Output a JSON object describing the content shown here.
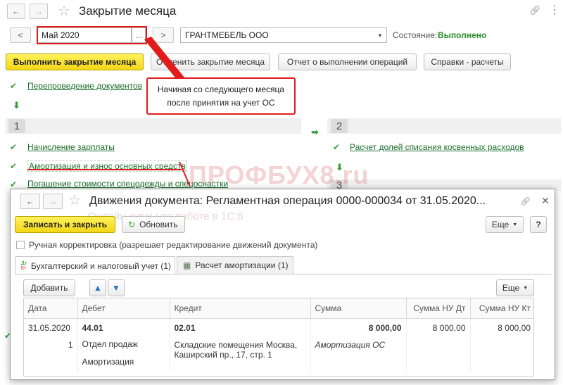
{
  "main": {
    "title": "Закрытие месяца",
    "period_value": "Май 2020",
    "period_picker": "...",
    "prev_label": "<",
    "next_label": ">",
    "org_value": "ГРАНТМЕБЕЛЬ ООО",
    "state_label": "Состояние:",
    "state_value": "Выполнено",
    "run_button": "Выполнить закрытие месяца",
    "cancel_button": "Отменить закрытие месяца",
    "report_button": "Отчет о выполнении операций",
    "refs_button": "Справки - расчеты",
    "step_repost": "Перепроведение документов",
    "group1_num": "1",
    "group2_num": "2",
    "group3_num": "3",
    "op_salary": "Начисление зарплаты",
    "op_depr": "Амортизация и износ основных средств",
    "op_workwear": "Погашение стоимости спецодежды и спецоснастки",
    "op_indirect": "Расчет долей списания косвенных расходов"
  },
  "callout": {
    "line1": "Начиная со следующего месяца",
    "line2": "после принятия на учет ОС"
  },
  "watermark": {
    "brand": "ПРОФБУХ8.ru",
    "tagline": "Онлайн-курсы по работе в 1С:8"
  },
  "dialog": {
    "title": "Движения документа: Регламентная операция 0000-000034 от 31.05.2020...",
    "save_close": "Записать и закрыть",
    "refresh": "Обновить",
    "more": "Еще",
    "help": "?",
    "manual_label": "Ручная корректировка (разрешает редактирование движений документа)",
    "tab1": "Бухгалтерский и налоговый учет (1)",
    "tab1_icon_top": "Дт",
    "tab1_icon_bottom": "Кт",
    "tab2": "Расчет амортизации (1)",
    "add": "Добавить",
    "more2": "Еще",
    "columns": {
      "date": "Дата",
      "debit": "Дебет",
      "credit": "Кредит",
      "sum": "Сумма",
      "sum_nu_dt": "Сумма НУ Дт",
      "sum_nu_kt": "Сумма НУ Кт"
    },
    "row": {
      "date": "31.05.2020",
      "num": "1",
      "debit_acc": "44.01",
      "debit_sub1": "Отдел продаж",
      "debit_sub2": "Амортизация",
      "credit_acc": "02.01",
      "credit_sub1": "Складские помещения Москва,",
      "credit_sub2": "Каширский пр., 17, стр. 1",
      "sum": "8 000,00",
      "content": "Амортизация ОС",
      "sum_nu_dt": "8 000,00",
      "sum_nu_kt": "8 000,00"
    }
  },
  "colors": {
    "accent_yellow": "#f5dd1f",
    "link_green": "#1a6d2b",
    "state_green": "#2a8a2a",
    "callout_red": "#e21b1b"
  }
}
